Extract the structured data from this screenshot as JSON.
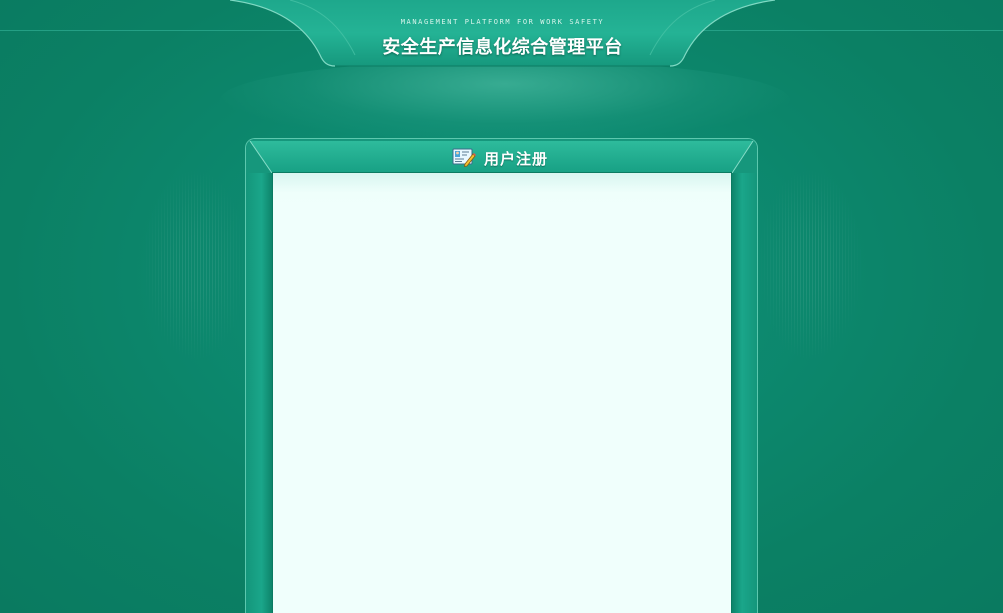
{
  "header": {
    "subtitle": "MANAGEMENT PLATFORM FOR WORK SAFETY",
    "title": "安全生产信息化综合管理平台"
  },
  "panel": {
    "icon": "user-edit-icon",
    "title": "用户注册"
  },
  "colors": {
    "background": "#0d8a70",
    "banner": "#1aa58a",
    "content": "#f0fffc"
  }
}
